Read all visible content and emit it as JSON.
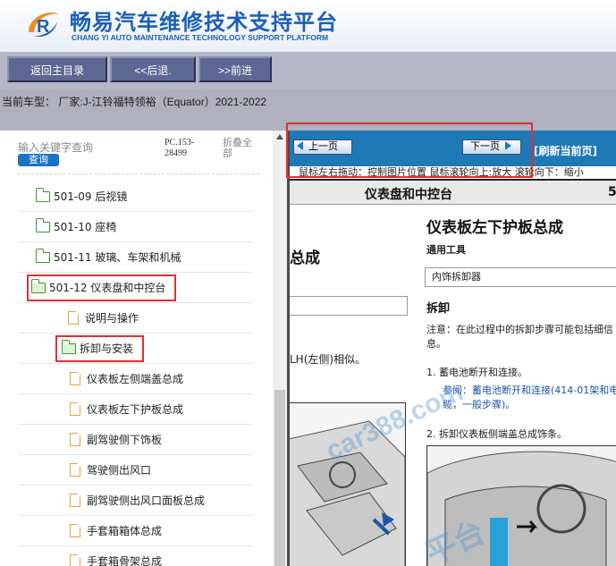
{
  "header": {
    "title_cn": "畅易汽车维修技术支持平台",
    "title_en": "CHANG YI AUTO MAINTENANCE TECHNOLOGY SUPPORT PLATFORM",
    "accent_color": "#1b5fb8"
  },
  "nav": {
    "home_label": "返回主目录",
    "back_label": "<<后退.",
    "forward_label": ">>前进"
  },
  "vehicle": {
    "current_text": "当前车型：  厂家:J-江铃福特领裕（Equator）2021-2022"
  },
  "sidebar": {
    "search_placeholder": "输入关键字查询",
    "search_button": "查询",
    "pc_code": "PC.153-28499",
    "fold_all": "折叠全部",
    "items": [
      {
        "label": "501-09 后视镜",
        "type": "folder"
      },
      {
        "label": "501-10 座椅",
        "type": "folder"
      },
      {
        "label": "501-11 玻璃、车架和机械",
        "type": "folder"
      },
      {
        "label": "501-12 仪表盘和中控台",
        "type": "folder-open"
      },
      {
        "label": "说明与操作",
        "type": "doc"
      },
      {
        "label": "拆卸与安装",
        "type": "folder-open"
      },
      {
        "label": "仪表板左侧端盖总成",
        "type": "doc"
      },
      {
        "label": "仪表板左下护板总成",
        "type": "doc"
      },
      {
        "label": "副驾驶侧下饰板",
        "type": "doc"
      },
      {
        "label": "驾驶侧出风口",
        "type": "doc"
      },
      {
        "label": "副驾驶侧出风口面板总成",
        "type": "doc"
      },
      {
        "label": "手套箱箱体总成",
        "type": "doc"
      },
      {
        "label": "手套箱骨架总成",
        "type": "doc"
      }
    ]
  },
  "viewer": {
    "prev_label": "上一页",
    "next_label": "下一页",
    "refresh_label": "[刷新当前页]",
    "hint": "鼠标左右拖动：控制图片位置  鼠标滚轮向上:放大  滚轮向下：缩小"
  },
  "document": {
    "header_title": "仪表盘和中控台",
    "header_num": "5",
    "left_title": "总成",
    "left_text": "LH(左侧)相似。",
    "title": "仪表板左下护板总成",
    "tools_heading": "通用工具",
    "tool_item": "内饰拆卸器",
    "section": "拆卸",
    "note": "注意：在此过程中的拆卸步骤可能包括细信息。",
    "step1": "1.  蓄电池断开和连接。",
    "step1_ref": "参阅：蓄电池断开和连接(414-01架和电缆，一般步骤)。",
    "step2": "2.  拆卸仪表板侧端盖总成饰条。",
    "watermark_1": "car388.com",
    "watermark_2": "平台"
  }
}
